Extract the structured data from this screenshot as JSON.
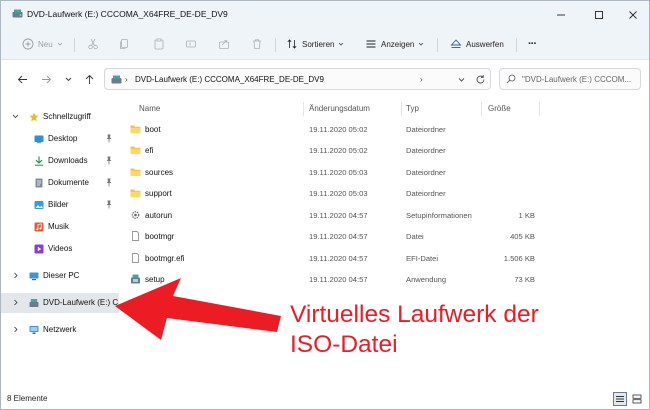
{
  "window": {
    "title": "DVD-Laufwerk (E:) CCCOMA_X64FRE_DE-DE_DV9",
    "title_icon": "dvd-drive-icon"
  },
  "toolbar": {
    "new_label": "Neu",
    "sort_label": "Sortieren",
    "view_label": "Anzeigen",
    "eject_label": "Auswerfen",
    "more_label": "···"
  },
  "address": {
    "path": "DVD-Laufwerk (E:) CCCOMA_X64FRE_DE-DE_DV9",
    "separator": "›",
    "search_placeholder": "\"DVD-Laufwerk (E:) CCCOM..."
  },
  "sidebar": {
    "items": [
      {
        "label": "Schnellzugriff",
        "icon": "star-icon",
        "expanded": true,
        "pinned": false
      },
      {
        "label": "Desktop",
        "icon": "desktop-icon",
        "pinned": true
      },
      {
        "label": "Downloads",
        "icon": "download-icon",
        "pinned": true
      },
      {
        "label": "Dokumente",
        "icon": "documents-icon",
        "pinned": true
      },
      {
        "label": "Bilder",
        "icon": "pictures-icon",
        "pinned": true
      },
      {
        "label": "Musik",
        "icon": "music-icon",
        "pinned": false
      },
      {
        "label": "Videos",
        "icon": "videos-icon",
        "pinned": false
      },
      {
        "label": "Dieser PC",
        "icon": "pc-icon",
        "expanded": false
      },
      {
        "label": "DVD-Laufwerk (E:) C",
        "icon": "dvd-drive-icon",
        "selected": true
      },
      {
        "label": "Netzwerk",
        "icon": "network-icon",
        "expanded": false
      }
    ]
  },
  "columns": {
    "name": "Name",
    "date": "Änderungsdatum",
    "type": "Typ",
    "size": "Größe"
  },
  "files": [
    {
      "name": "boot",
      "date": "19.11.2020 05:02",
      "type": "Dateiordner",
      "size": "",
      "icon": "folder-icon"
    },
    {
      "name": "efi",
      "date": "19.11.2020 05:02",
      "type": "Dateiordner",
      "size": "",
      "icon": "folder-icon"
    },
    {
      "name": "sources",
      "date": "19.11.2020 05:03",
      "type": "Dateiordner",
      "size": "",
      "icon": "folder-icon"
    },
    {
      "name": "support",
      "date": "19.11.2020 05:03",
      "type": "Dateiordner",
      "size": "",
      "icon": "folder-icon"
    },
    {
      "name": "autorun",
      "date": "19.11.2020 04:57",
      "type": "Setupinformationen",
      "size": "1 KB",
      "icon": "settings-file-icon"
    },
    {
      "name": "bootmgr",
      "date": "19.11.2020 04:57",
      "type": "Datei",
      "size": "405 KB",
      "icon": "file-icon"
    },
    {
      "name": "bootmgr.efi",
      "date": "19.11.2020 04:57",
      "type": "EFI-Datei",
      "size": "1.506 KB",
      "icon": "file-icon"
    },
    {
      "name": "setup",
      "date": "19.11.2020 04:57",
      "type": "Anwendung",
      "size": "73 KB",
      "icon": "setup-app-icon"
    }
  ],
  "status": {
    "count": "8 Elemente"
  },
  "annotation": {
    "line1": "Virtuelles Laufwerk der",
    "line2": "ISO-Datei",
    "color": "#ec1c24"
  },
  "colors": {
    "chrome": "#eff4f9",
    "folder": "#f5c142",
    "accent": "#0067c0"
  }
}
